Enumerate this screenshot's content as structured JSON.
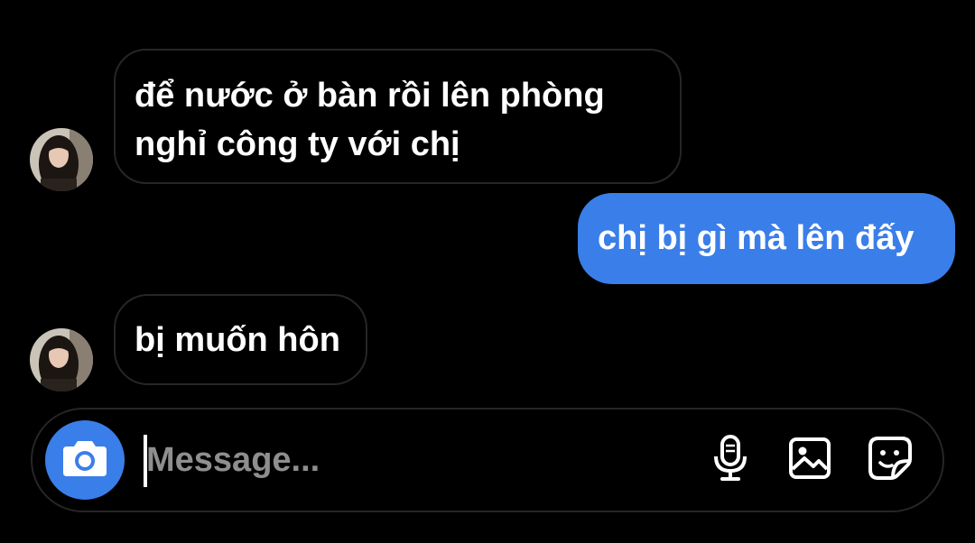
{
  "messages": [
    {
      "direction": "incoming",
      "text": "để nước ở bàn rồi lên phòng nghỉ công ty với chị"
    },
    {
      "direction": "outgoing",
      "text": "chị bị gì mà lên đấy"
    },
    {
      "direction": "incoming",
      "text": "bị muốn hôn"
    }
  ],
  "composer": {
    "placeholder": "Message...",
    "value": "",
    "icons": [
      "camera-icon",
      "microphone-icon",
      "gallery-icon",
      "sticker-icon"
    ]
  },
  "colors": {
    "background": "#000000",
    "accent": "#3a7ee9",
    "bubble_border": "#262626",
    "placeholder": "#8e8e8e"
  }
}
